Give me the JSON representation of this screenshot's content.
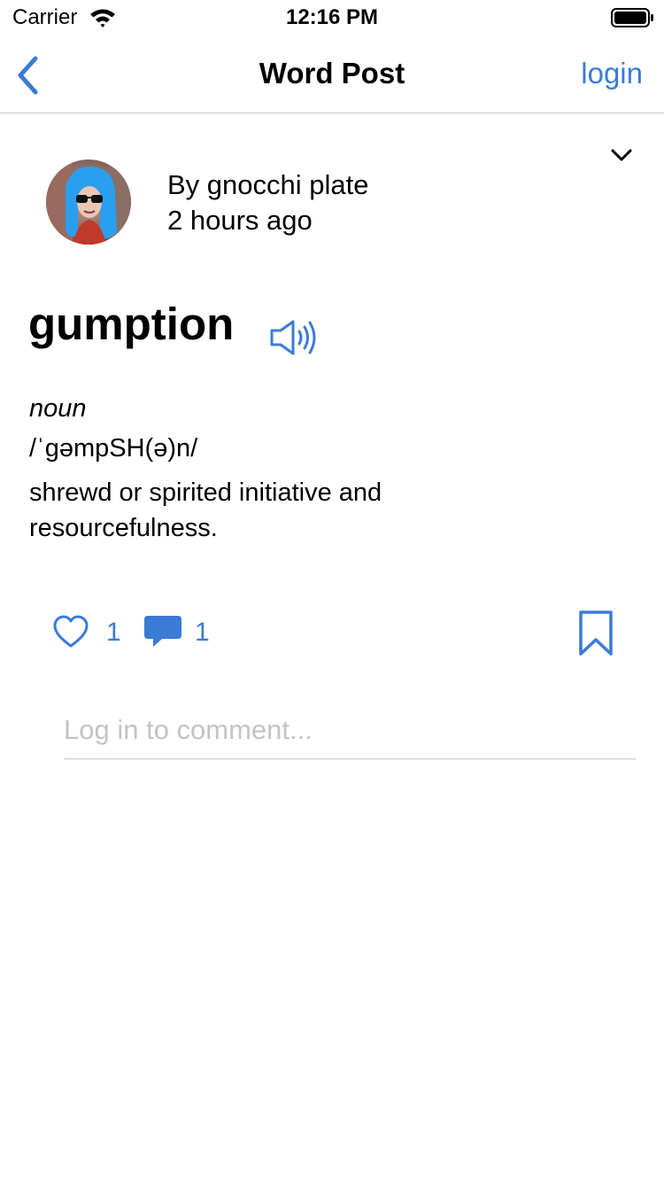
{
  "status_bar": {
    "carrier": "Carrier",
    "time": "12:16 PM"
  },
  "nav": {
    "title": "Word Post",
    "login_label": "login"
  },
  "post": {
    "author_line": "By gnocchi plate",
    "time_ago": "2 hours ago",
    "word": "gumption",
    "part_of_speech": "noun",
    "pronunciation": "/ˈɡəmpSH(ə)n/",
    "definition": "shrewd or spirited initiative and resourcefulness."
  },
  "actions": {
    "likes": "1",
    "comments": "1"
  },
  "comment_box": {
    "placeholder": "Log in to comment..."
  },
  "colors": {
    "accent": "#3a7bd5",
    "divider": "#c8c8c8",
    "placeholder": "#c4c4c6"
  },
  "icons": [
    "wifi-icon",
    "battery-icon",
    "back-chevron-icon",
    "chevron-down-icon",
    "speaker-icon",
    "heart-icon",
    "comment-bubble-icon",
    "bookmark-icon"
  ]
}
